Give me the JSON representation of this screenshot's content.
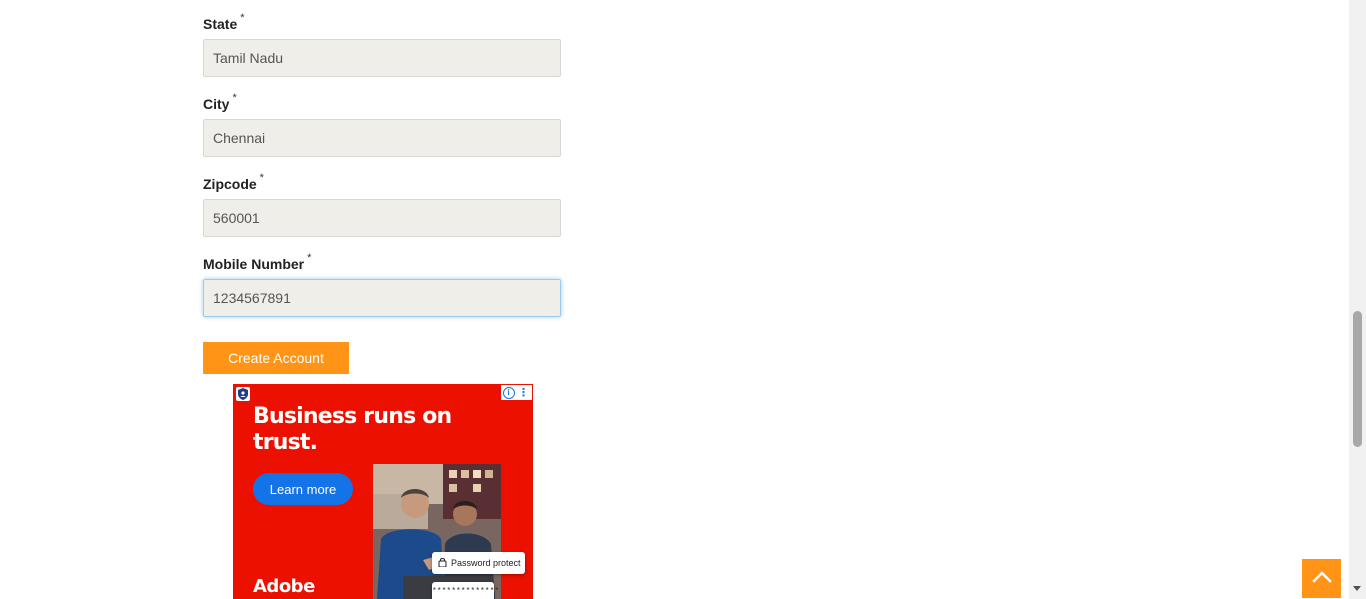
{
  "form": {
    "state": {
      "label": "State",
      "required_mark": "*",
      "value": "Tamil Nadu"
    },
    "city": {
      "label": "City",
      "required_mark": "*",
      "value": "Chennai"
    },
    "zipcode": {
      "label": "Zipcode",
      "required_mark": "*",
      "value": "560001"
    },
    "mobile": {
      "label": "Mobile Number",
      "required_mark": "*",
      "value": "1234567891"
    },
    "submit_label": "Create Account"
  },
  "ad": {
    "headline": "Business runs on trust.",
    "cta": "Learn more",
    "brand": "Adobe",
    "chip_label": "Password protect",
    "chip_masked": "**************",
    "info_symbol": "i",
    "menu_symbol": "⋮",
    "background_color": "#eb1000",
    "cta_color": "#1473e6"
  },
  "back_to_top": {
    "icon": "chevron-up-icon"
  },
  "colors": {
    "accent": "#ff9416",
    "input_bg": "#efeee8",
    "focus_ring": "#9ecaed"
  }
}
